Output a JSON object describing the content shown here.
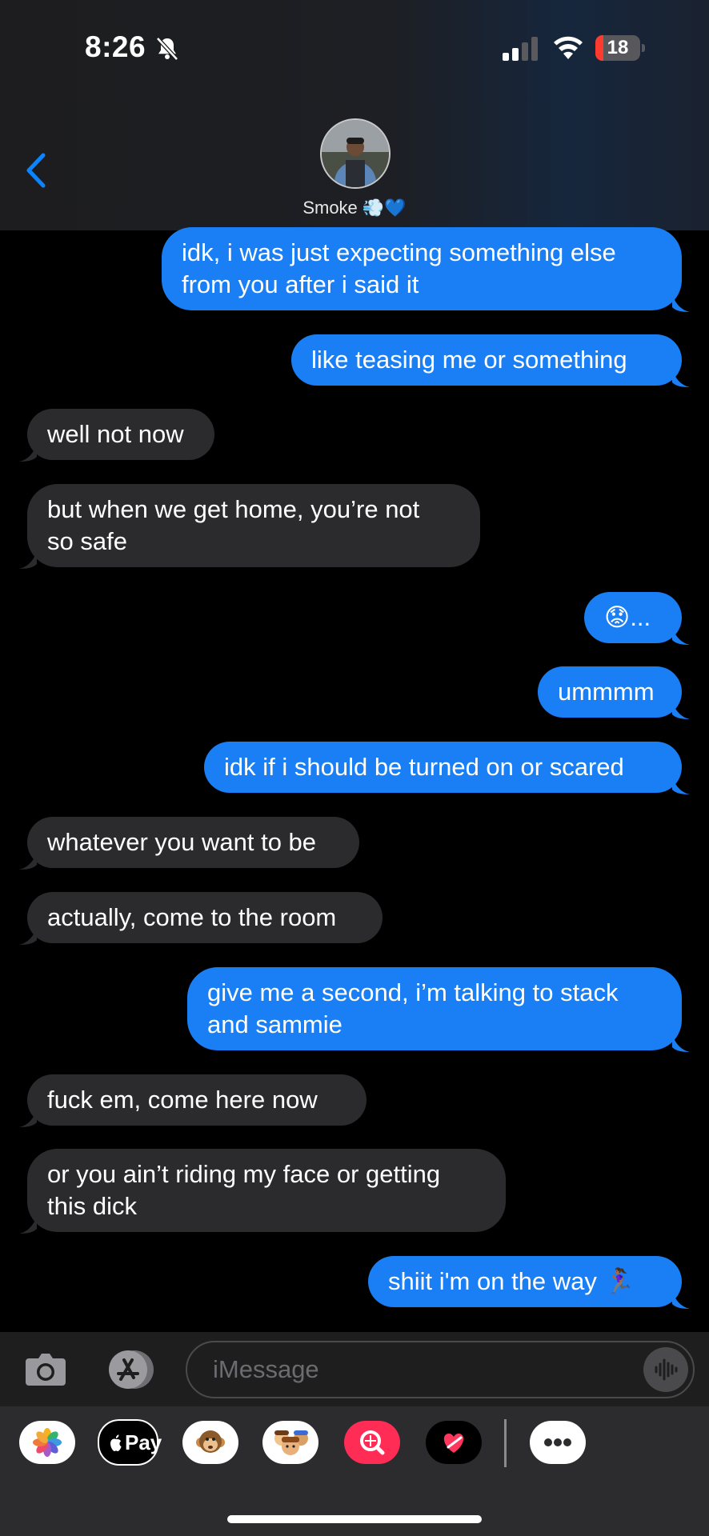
{
  "status_bar": {
    "time": "8:26",
    "battery": "18",
    "battery_level_pct": 18
  },
  "header": {
    "contact_name": "Smoke 💨💙"
  },
  "messages": [
    {
      "from": "me",
      "lines": [
        "idk, i was just expecting something else",
        "from you after i said it"
      ]
    },
    {
      "from": "me",
      "lines": [
        "like teasing me or something"
      ]
    },
    {
      "from": "them",
      "lines": [
        "well not now"
      ]
    },
    {
      "from": "them",
      "lines": [
        "but when we get home, you’re not",
        "so safe"
      ]
    },
    {
      "from": "me",
      "lines": [
        "😟..."
      ]
    },
    {
      "from": "me",
      "lines": [
        "ummmm"
      ]
    },
    {
      "from": "me",
      "lines": [
        "idk if i should be turned on or scared"
      ]
    },
    {
      "from": "them",
      "lines": [
        "whatever you want to be"
      ]
    },
    {
      "from": "them",
      "lines": [
        "actually, come to the room"
      ]
    },
    {
      "from": "me",
      "lines": [
        "give me a second, i’m talking to stack",
        "and sammie"
      ]
    },
    {
      "from": "them",
      "lines": [
        "fuck em, come here now"
      ]
    },
    {
      "from": "them",
      "lines": [
        "or you ain’t riding my face or getting",
        "this dick"
      ]
    },
    {
      "from": "me",
      "lines": [
        "shiit i'm on the way 🏃🏾‍♀️"
      ]
    }
  ],
  "input": {
    "placeholder": "iMessage"
  },
  "app_strip": {
    "apple_pay_label": "Pay",
    "apps": [
      "photos-icon",
      "apple-pay-icon",
      "monkey-memoji-icon",
      "memoji-stickers-icon",
      "image-search-icon",
      "digital-touch-icon",
      "more-icon"
    ]
  },
  "colors": {
    "sent_bubble": "#1a7ff5",
    "received_bubble": "#2b2b2d",
    "accent": "#0a84ff"
  }
}
